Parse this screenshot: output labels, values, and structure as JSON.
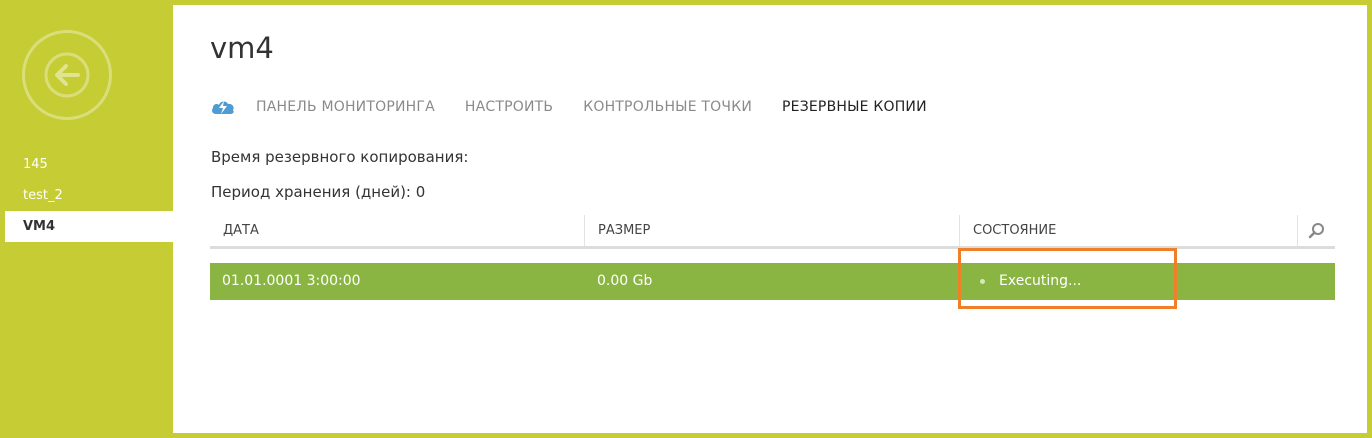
{
  "sidebar": {
    "back_icon": "back-arrow-icon",
    "items": [
      {
        "label": "145"
      },
      {
        "label": "test_2"
      },
      {
        "label": "VM4"
      }
    ]
  },
  "page": {
    "title": "vm4"
  },
  "tabs": {
    "logo_icon": "cloud-logo-icon",
    "items": [
      {
        "label": "ПАНЕЛЬ МОНИТОРИНГА"
      },
      {
        "label": "НАСТРОИТЬ"
      },
      {
        "label": "КОНТРОЛЬНЫЕ ТОЧКИ"
      },
      {
        "label": "РЕЗЕРВНЫЕ КОПИИ"
      }
    ],
    "active": "РЕЗЕРВНЫЕ КОПИИ"
  },
  "info": {
    "backup_time_label": "Время резервного копирования:",
    "retention_label": "Период хранения (дней): 0"
  },
  "table": {
    "columns": [
      "ДАТА",
      "РАЗМЕР",
      "СОСТОЯНИЕ"
    ],
    "search_icon": "search-icon",
    "rows": [
      {
        "date": "01.01.0001 3:00:00",
        "size": "0.00 Gb",
        "state": "Executing..."
      }
    ]
  },
  "colors": {
    "background": "#c6cc34",
    "row_selected": "#8bb543",
    "highlight": "#f07f2a"
  }
}
